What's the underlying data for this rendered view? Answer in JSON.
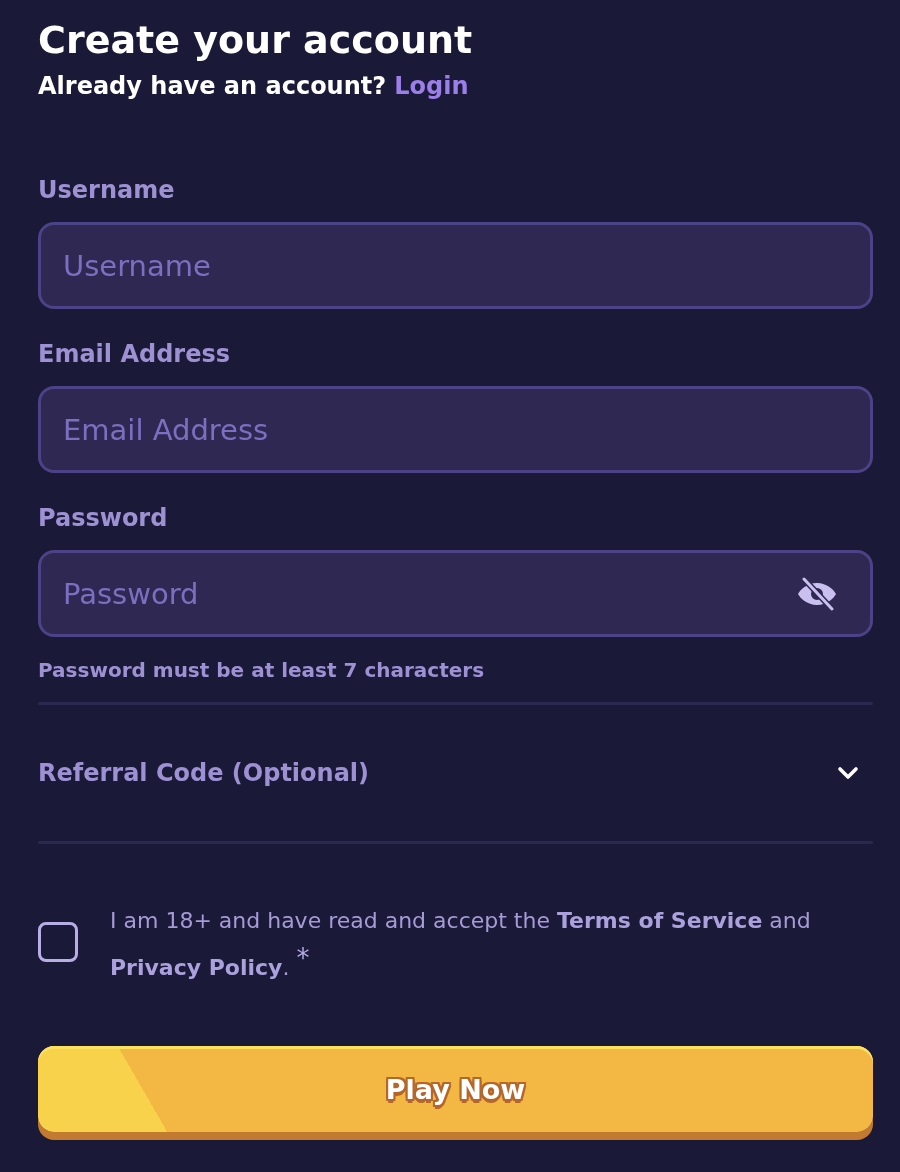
{
  "header": {
    "title": "Create your account",
    "subtitle": "Already have an account?",
    "login_link": "Login"
  },
  "fields": [
    {
      "kind": "text",
      "label": "Username",
      "placeholder": "Username"
    },
    {
      "kind": "email",
      "label": "Email Address",
      "placeholder": "Email Address"
    },
    {
      "kind": "password",
      "label": "Password",
      "placeholder": "Password",
      "helper": "Password must be at least 7 characters"
    }
  ],
  "referral": {
    "label": "Referral Code (Optional)",
    "expanded": false
  },
  "agreement": {
    "checked": false,
    "parts": [
      {
        "kind": "text",
        "text": "I am 18+ and have read and accept the "
      },
      {
        "kind": "link",
        "text": "Terms of Service"
      },
      {
        "kind": "text",
        "text": " and "
      },
      {
        "kind": "link",
        "text": "Privacy Policy"
      },
      {
        "kind": "text",
        "text": ". "
      },
      {
        "kind": "required",
        "text": "*"
      }
    ]
  },
  "submit": {
    "label": "Play Now"
  }
}
